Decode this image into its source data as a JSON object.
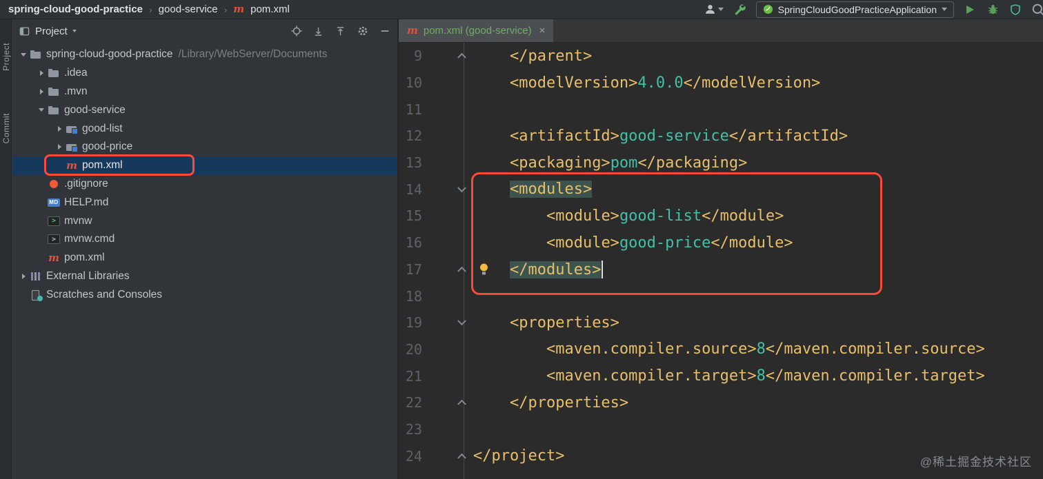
{
  "topbar": {
    "breadcrumbs": [
      {
        "label": "spring-cloud-good-practice",
        "bold": true
      },
      {
        "label": "good-service"
      },
      {
        "label": "pom.xml",
        "icon": "maven"
      }
    ],
    "run_config_name": "SpringCloudGoodPracticeApplication"
  },
  "tool_stripe": {
    "project_label": "Project",
    "commit_label": "Commit"
  },
  "project_panel": {
    "title": "Project",
    "tree": [
      {
        "label": "spring-cloud-good-practice",
        "path": "/Library/WebServer/Documents",
        "icon": "folder",
        "indent": 0,
        "chevron": "down"
      },
      {
        "label": ".idea",
        "icon": "folder",
        "indent": 1,
        "chevron": "right"
      },
      {
        "label": ".mvn",
        "icon": "folder",
        "indent": 1,
        "chevron": "right"
      },
      {
        "label": "good-service",
        "icon": "folder",
        "indent": 1,
        "chevron": "down"
      },
      {
        "label": "good-list",
        "icon": "module-folder",
        "indent": 2,
        "chevron": "right"
      },
      {
        "label": "good-price",
        "icon": "module-folder",
        "indent": 2,
        "chevron": "right"
      },
      {
        "label": "pom.xml",
        "icon": "maven",
        "indent": 2,
        "selected": true
      },
      {
        "label": ".gitignore",
        "icon": "git",
        "indent": 1
      },
      {
        "label": "HELP.md",
        "icon": "markdown",
        "indent": 1
      },
      {
        "label": "mvnw",
        "icon": "shell",
        "indent": 1
      },
      {
        "label": "mvnw.cmd",
        "icon": "cmd",
        "indent": 1
      },
      {
        "label": "pom.xml",
        "icon": "maven",
        "indent": 1
      },
      {
        "label": "External Libraries",
        "icon": "libraries",
        "indent": 0,
        "chevron": "right"
      },
      {
        "label": "Scratches and Consoles",
        "icon": "scratches",
        "indent": 0
      }
    ]
  },
  "editor": {
    "tab_label": "pom.xml (good-service)",
    "tab_close": "×",
    "lines": [
      {
        "num": "9",
        "indent": 1,
        "fold": "up",
        "tokens": [
          {
            "c": "tag",
            "t": "</parent>"
          }
        ]
      },
      {
        "num": "10",
        "indent": 1,
        "tokens": [
          {
            "c": "tag",
            "t": "<modelVersion>"
          },
          {
            "c": "val",
            "t": "4.0.0"
          },
          {
            "c": "tag",
            "t": "</modelVersion>"
          }
        ]
      },
      {
        "num": "11",
        "indent": 0,
        "tokens": []
      },
      {
        "num": "12",
        "indent": 1,
        "tokens": [
          {
            "c": "tag",
            "t": "<artifactId>"
          },
          {
            "c": "val",
            "t": "good-service"
          },
          {
            "c": "tag",
            "t": "</artifactId>"
          }
        ]
      },
      {
        "num": "13",
        "indent": 1,
        "tokens": [
          {
            "c": "tag",
            "t": "<packaging>"
          },
          {
            "c": "val",
            "t": "pom"
          },
          {
            "c": "tag",
            "t": "</packaging>"
          }
        ]
      },
      {
        "num": "14",
        "indent": 1,
        "fold": "down",
        "tokens": [
          {
            "c": "tag hl",
            "t": "<modules>"
          }
        ]
      },
      {
        "num": "15",
        "indent": 2,
        "tokens": [
          {
            "c": "tag",
            "t": "<module>"
          },
          {
            "c": "val",
            "t": "good-list"
          },
          {
            "c": "tag",
            "t": "</module>"
          }
        ]
      },
      {
        "num": "16",
        "indent": 2,
        "tokens": [
          {
            "c": "tag",
            "t": "<module>"
          },
          {
            "c": "val",
            "t": "good-price"
          },
          {
            "c": "tag",
            "t": "</module>"
          }
        ]
      },
      {
        "num": "17",
        "indent": 1,
        "fold": "up",
        "bulb": true,
        "cursor": true,
        "tokens": [
          {
            "c": "tag hl",
            "t": "</modules>"
          }
        ]
      },
      {
        "num": "18",
        "indent": 0,
        "tokens": []
      },
      {
        "num": "19",
        "indent": 1,
        "fold": "down",
        "tokens": [
          {
            "c": "tag",
            "t": "<properties>"
          }
        ]
      },
      {
        "num": "20",
        "indent": 2,
        "tokens": [
          {
            "c": "tag",
            "t": "<maven.compiler.source>"
          },
          {
            "c": "val",
            "t": "8"
          },
          {
            "c": "tag",
            "t": "</maven.compiler.source>"
          }
        ]
      },
      {
        "num": "21",
        "indent": 2,
        "tokens": [
          {
            "c": "tag",
            "t": "<maven.compiler.target>"
          },
          {
            "c": "val",
            "t": "8"
          },
          {
            "c": "tag",
            "t": "</maven.compiler.target>"
          }
        ]
      },
      {
        "num": "22",
        "indent": 1,
        "fold": "up",
        "tokens": [
          {
            "c": "tag",
            "t": "</properties>"
          }
        ]
      },
      {
        "num": "23",
        "indent": 0,
        "tokens": []
      },
      {
        "num": "24",
        "indent": 0,
        "fold": "up",
        "tokens": [
          {
            "c": "tag",
            "t": "</project>"
          }
        ]
      }
    ]
  },
  "icons": {
    "user": "person-silhouette",
    "build": "wrench",
    "spring_boot": "green-leaf-circle",
    "run": "green-play-triangle",
    "debug": "green-bug",
    "coverage": "teal-shield",
    "search": "magnifier",
    "maven": "m",
    "markdown": "MD",
    "shell": ">",
    "cmd": ">"
  },
  "colors": {
    "xml_tag": "#e8bf6a",
    "xml_value": "#42c1a7",
    "tag_match_highlight": "#3d534d",
    "tree_selection": "#16395b",
    "annotation_red": "#fb4a37",
    "run_green": "#58a158",
    "tab_text_green": "#72ab64"
  },
  "watermark": "@稀土掘金技术社区"
}
